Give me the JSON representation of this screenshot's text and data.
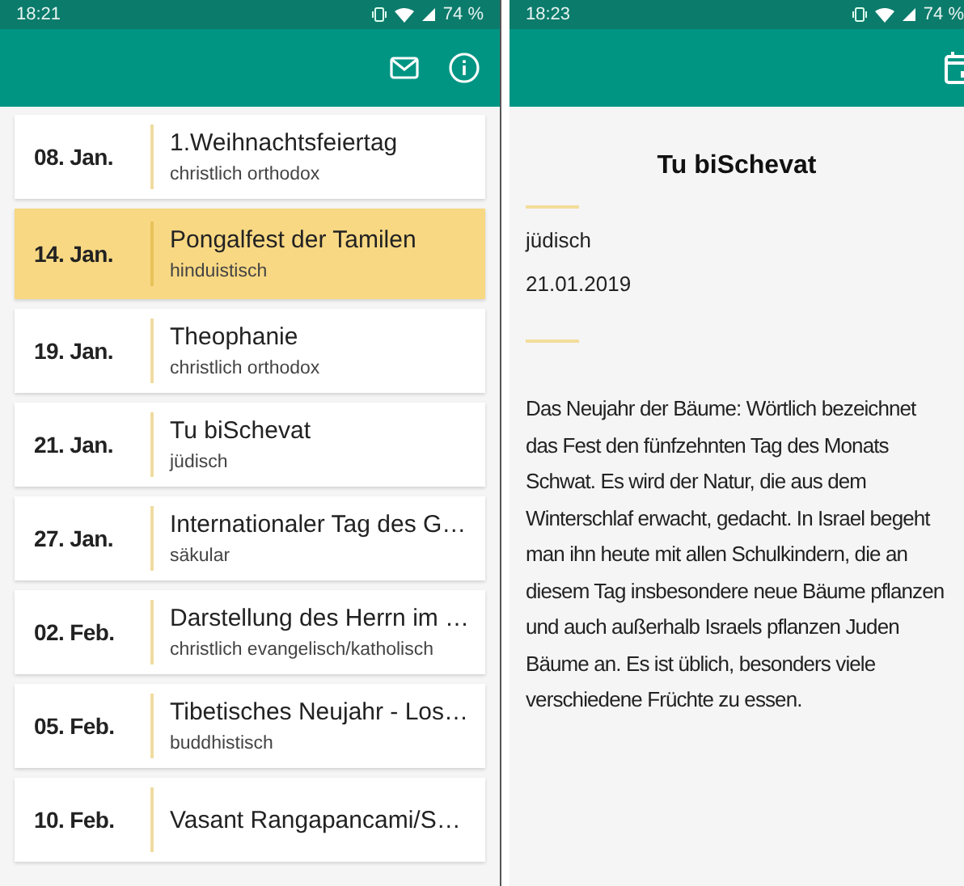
{
  "list_screen": {
    "status_bar": {
      "time": "18:21",
      "battery": "74 %"
    },
    "toolbar": {
      "actions": [
        {
          "kind": "mail"
        },
        {
          "kind": "info"
        }
      ]
    },
    "holidays": [
      {
        "date": "08. Jan.",
        "title": "1.Weihnachtsfeiertag",
        "religion": "christlich orthodox",
        "selected": false
      },
      {
        "date": "14. Jan.",
        "title": "Pongalfest der Tamilen",
        "religion": "hinduistisch",
        "selected": true
      },
      {
        "date": "19. Jan.",
        "title": "Theophanie",
        "religion": "christlich orthodox",
        "selected": false
      },
      {
        "date": "21. Jan.",
        "title": "Tu biSchevat",
        "religion": "jüdisch",
        "selected": false
      },
      {
        "date": "27. Jan.",
        "title": "Internationaler Tag des G…",
        "religion": "säkular",
        "selected": false
      },
      {
        "date": "02. Feb.",
        "title": "Darstellung des Herrn im …",
        "religion": "christlich evangelisch/katholisch",
        "selected": false
      },
      {
        "date": "05. Feb.",
        "title": "Tibetisches Neujahr - Los…",
        "religion": "buddhistisch",
        "selected": false
      },
      {
        "date": "10. Feb.",
        "title": "Vasant Rangapancami/S…",
        "selected": false
      }
    ]
  },
  "detail_screen": {
    "status_bar": {
      "time": "18:23",
      "battery": "74 %"
    },
    "toolbar": {
      "actions": [
        {
          "kind": "calendar"
        }
      ]
    },
    "title": "Tu biSchevat",
    "religion": "jüdisch",
    "date": "21.01.2019",
    "description": "Das Neujahr der Bäume: Wörtlich bezeichnet das Fest den fünfzehnten Tag des Monats Schwat. Es wird der Natur, die aus dem Winterschlaf erwacht, gedacht. In Israel begeht man ihn heute mit allen Schulkindern, die an diesem Tag insbesondere neue Bäume pflanzen und auch außerhalb Israels pflanzen Juden Bäume an. Es ist üblich, besonders viele verschiedene Früchte zu essen."
  }
}
